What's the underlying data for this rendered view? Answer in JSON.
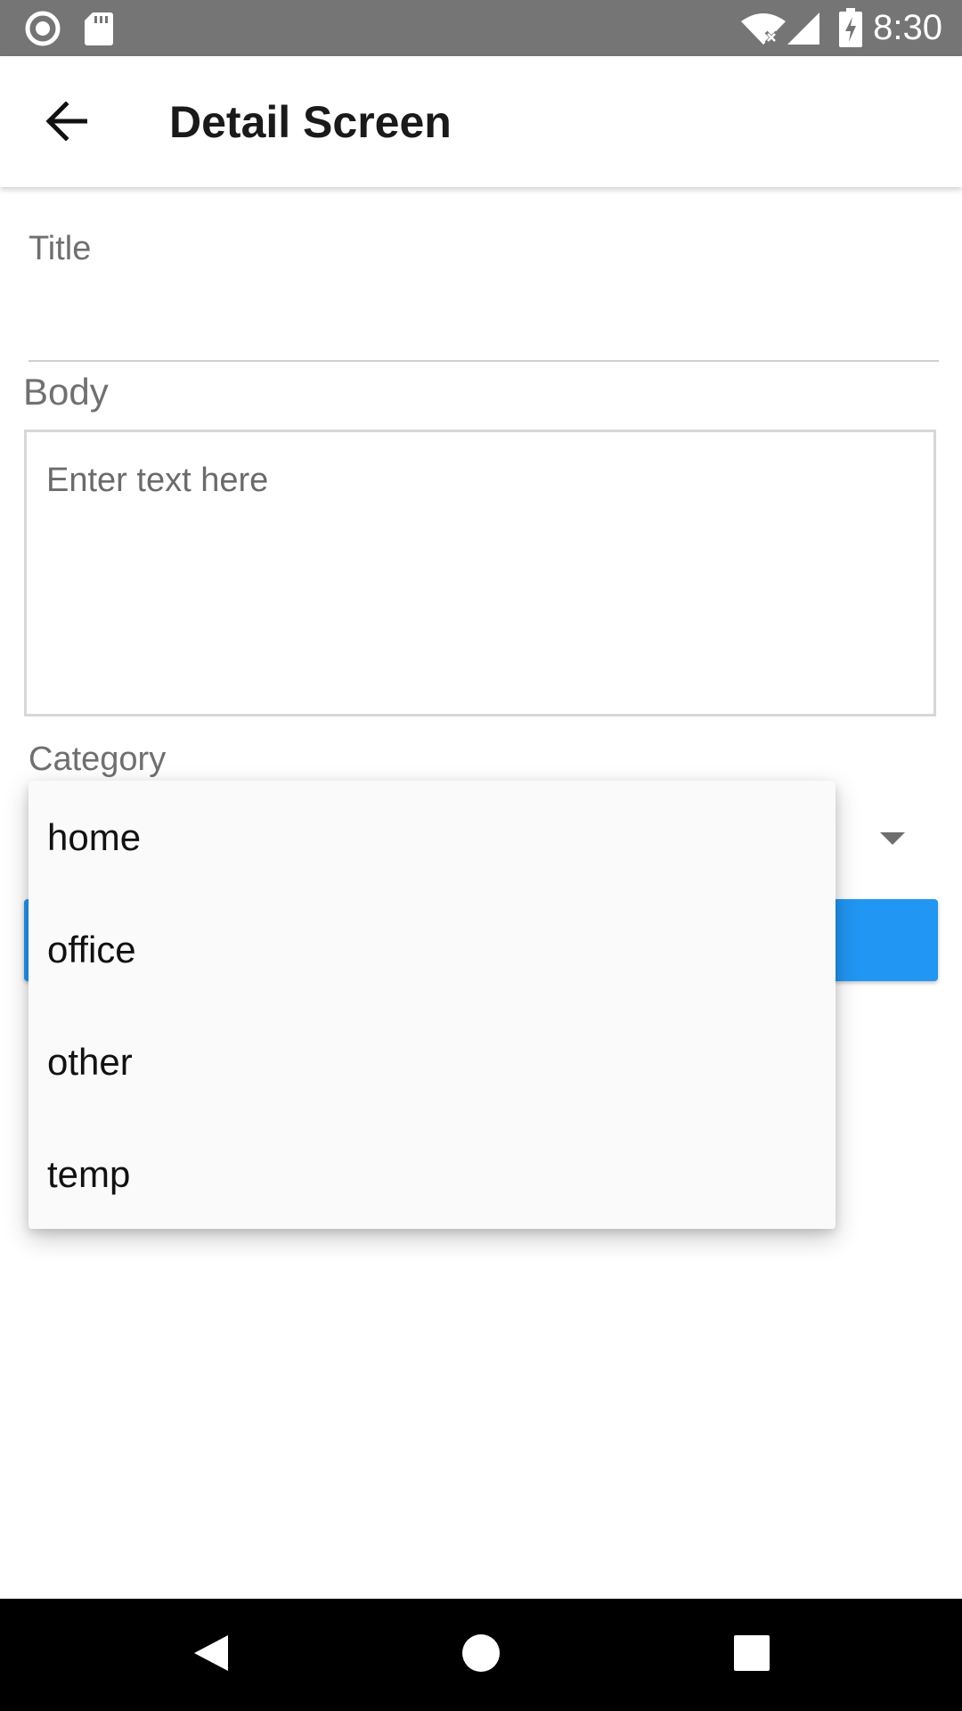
{
  "status_bar": {
    "time": "8:30",
    "icons": [
      "record-icon",
      "sd-card-icon",
      "wifi-icon",
      "signal-icon",
      "battery-charging-icon"
    ]
  },
  "app_bar": {
    "back_icon": "arrow-back-icon",
    "title": "Detail Screen"
  },
  "form": {
    "title_label": "Title",
    "title_value": "",
    "body_label": "Body",
    "body_placeholder": "Enter text here",
    "body_value": "",
    "category_label": "Category",
    "category_dropdown_icon": "arrow-drop-down-icon",
    "save_button_label": ""
  },
  "category_menu": {
    "items": [
      {
        "label": "home"
      },
      {
        "label": "office"
      },
      {
        "label": "other"
      },
      {
        "label": "temp"
      }
    ]
  },
  "nav_bar": {
    "back_icon": "nav-back-icon",
    "home_icon": "nav-home-icon",
    "recents_icon": "nav-recents-icon"
  },
  "colors": {
    "status_bar": "#757575",
    "accent": "#2196f3",
    "menu_background": "#fafafa",
    "nav_bar": "#000000"
  }
}
